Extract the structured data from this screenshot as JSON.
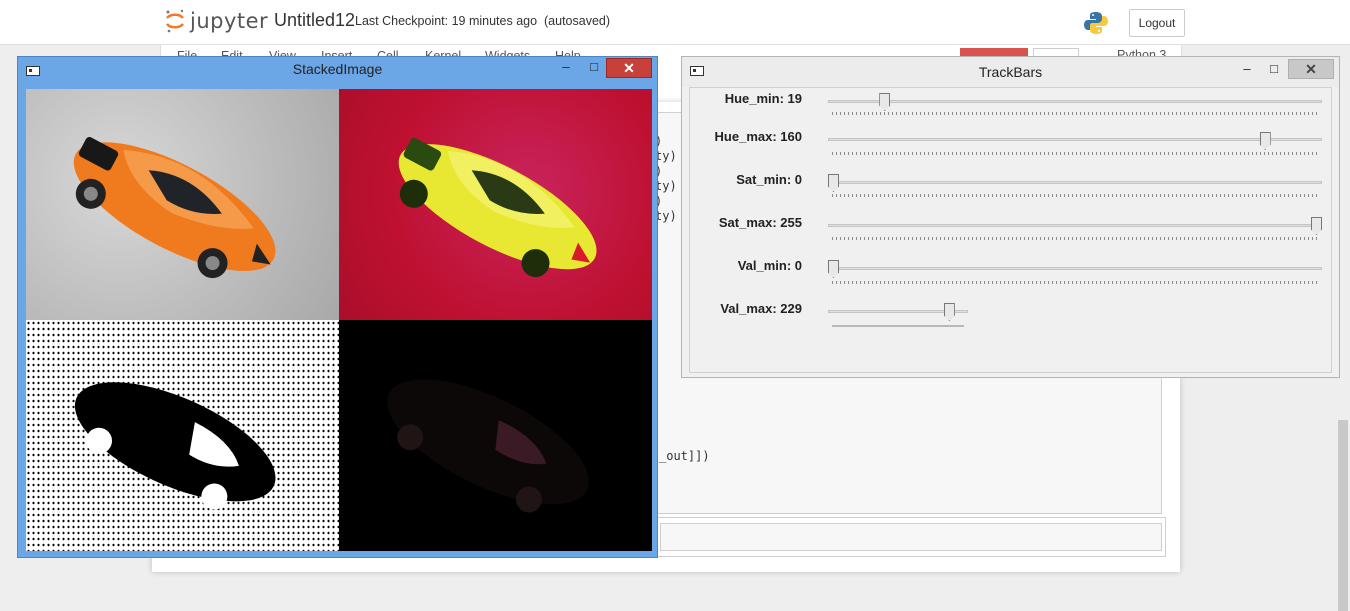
{
  "jupyter": {
    "logo_text": "jupyter",
    "notebook_name": "Untitled12",
    "checkpoint": "Last Checkpoint: 19 minutes ago",
    "autosave": "(autosaved)",
    "logout": "Logout",
    "menu": [
      "File",
      "Edit",
      "View",
      "Insert",
      "Cell",
      "Kernel",
      "Widgets",
      "Help"
    ],
    "kernel_label": "Python 3",
    "code_lines": [
      ")",
      "ty)",
      ")",
      "ty)",
      ")",
      "ty)",
      "_out]])"
    ]
  },
  "stacked_window": {
    "title": "StackedImage"
  },
  "trackbars_window": {
    "title": "TrackBars",
    "bars": [
      {
        "label": "Hue_min: 19",
        "value": 19,
        "max": 179
      },
      {
        "label": "Hue_max: 160",
        "value": 160,
        "max": 179
      },
      {
        "label": "Sat_min: 0",
        "value": 0,
        "max": 255
      },
      {
        "label": "Sat_max: 255",
        "value": 255,
        "max": 255
      },
      {
        "label": "Val_min: 0",
        "value": 0,
        "max": 255
      },
      {
        "label": "Val_max: 229",
        "value": 229,
        "max": 255
      }
    ]
  },
  "colors": {
    "win_active": "#6ba6e6",
    "close_red": "#c7403a",
    "hsv_red": "#bf1030",
    "car_orange": "#f07a1e",
    "car_yellow": "#e8e832"
  }
}
